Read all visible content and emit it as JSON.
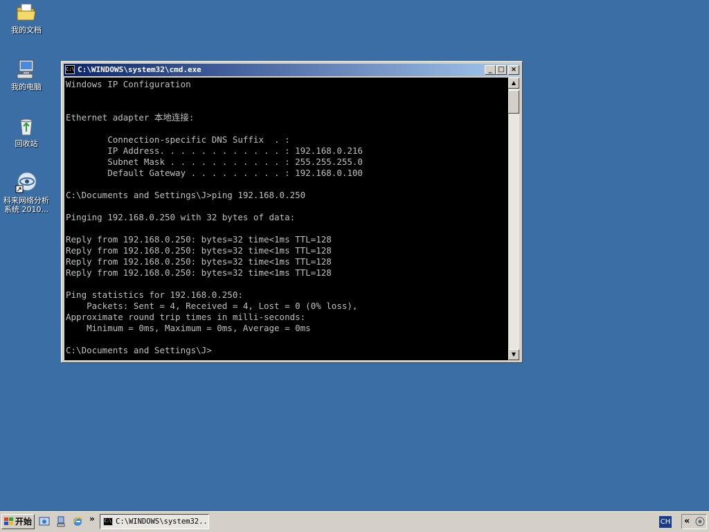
{
  "desktop": {
    "icons": [
      {
        "label": "我的文档",
        "icon": "folder-documents-icon"
      },
      {
        "label": "我的电脑",
        "icon": "computer-icon"
      },
      {
        "label": "回收站",
        "icon": "recycle-bin-icon"
      },
      {
        "label_line1": "科来网络分析",
        "label_line2": "系统 2010...",
        "icon": "network-analyzer-icon"
      }
    ]
  },
  "window": {
    "title": "C:\\WINDOWS\\system32\\cmd.exe",
    "icon_text": "C:\\",
    "buttons": {
      "minimize": "_",
      "maximize": "□",
      "close": "×"
    }
  },
  "console": {
    "lines": [
      "Windows IP Configuration",
      "",
      "",
      "Ethernet adapter 本地连接:",
      "",
      "        Connection-specific DNS Suffix  . :",
      "        IP Address. . . . . . . . . . . . : 192.168.0.216",
      "        Subnet Mask . . . . . . . . . . . : 255.255.255.0",
      "        Default Gateway . . . . . . . . . : 192.168.0.100",
      "",
      "C:\\Documents and Settings\\J>ping 192.168.0.250",
      "",
      "Pinging 192.168.0.250 with 32 bytes of data:",
      "",
      "Reply from 192.168.0.250: bytes=32 time<1ms TTL=128",
      "Reply from 192.168.0.250: bytes=32 time<1ms TTL=128",
      "Reply from 192.168.0.250: bytes=32 time<1ms TTL=128",
      "Reply from 192.168.0.250: bytes=32 time<1ms TTL=128",
      "",
      "Ping statistics for 192.168.0.250:",
      "    Packets: Sent = 4, Received = 4, Lost = 0 (0% loss),",
      "Approximate round trip times in milli-seconds:",
      "    Minimum = 0ms, Maximum = 0ms, Average = 0ms",
      "",
      "C:\\Documents and Settings\\J>"
    ]
  },
  "taskbar": {
    "start_label": "开始",
    "quicklaunch_more": "»",
    "task_title": "C:\\WINDOWS\\system32...",
    "language": "CH",
    "tray_arrows": "«"
  },
  "colors": {
    "desktop": "#3a6ea5",
    "title_active_start": "#0a246a",
    "title_active_end": "#a6caf0",
    "console_bg": "#000000",
    "console_fg": "#c0c0c0"
  }
}
